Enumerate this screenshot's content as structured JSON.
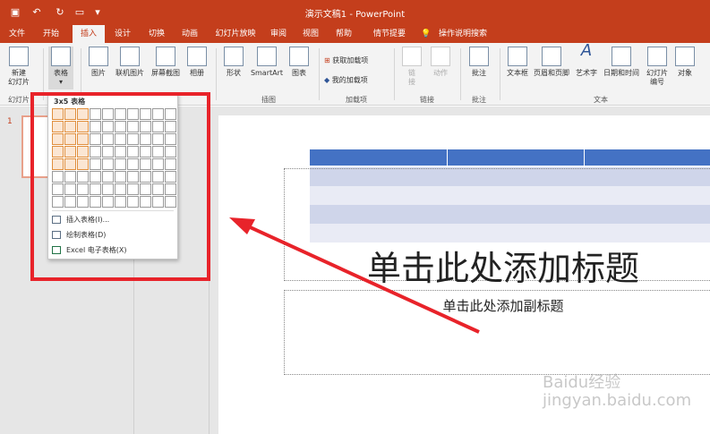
{
  "app": {
    "title": "演示文稿1  -  PowerPoint"
  },
  "quick_access": [
    {
      "icon": "save-icon",
      "glyph": "▣"
    },
    {
      "icon": "undo-icon",
      "glyph": "↶"
    },
    {
      "icon": "redo-icon",
      "glyph": "↻"
    },
    {
      "icon": "start-from-beginning-icon",
      "glyph": "▭"
    },
    {
      "icon": "customize-qat-icon",
      "glyph": "▾"
    }
  ],
  "tabs": [
    "文件",
    "开始",
    "插入",
    "设计",
    "切换",
    "动画",
    "幻灯片放映",
    "审阅",
    "视图",
    "帮助",
    "情节提要"
  ],
  "active_tab": "插入",
  "tell_me": "操作说明搜索",
  "ribbon": {
    "new_slide": "新建\n幻灯片",
    "table": "表格",
    "picture": "图片",
    "online_picture": "联机图片",
    "screenshot": "屏幕截图",
    "album": "相册",
    "shapes": "形状",
    "smartart": "SmartArt",
    "chart": "图表",
    "get_addins": "获取加载项",
    "my_addins": "我的加载项",
    "link": "链\n接",
    "action": "动作",
    "comment": "批注",
    "textbox": "文本框",
    "header_footer": "页眉和页脚",
    "wordart": "艺术字",
    "datetime": "日期和时间",
    "slide_number": "幻灯片\n编号",
    "object": "对象",
    "groups": {
      "slides": "幻灯片",
      "illustrations": "插图",
      "addins": "加载项",
      "links": "链接",
      "comments": "批注",
      "text": "文本"
    }
  },
  "table_dropdown": {
    "title": "3x5 表格",
    "rows": 8,
    "cols": 10,
    "selected_cols": 3,
    "selected_rows": 5,
    "items": [
      "插入表格(I)...",
      "绘制表格(D)",
      "Excel 电子表格(X)"
    ]
  },
  "slide_thumbnail_number": "1",
  "slide": {
    "title_placeholder": "单击此处添加标题",
    "subtitle_placeholder": "单击此处添加副标题"
  },
  "watermark": "Baidu经验\njingyan.baidu.com",
  "colors": {
    "accent": "#c43e1c",
    "annotation": "#e8232a",
    "table_header": "#4472c4"
  }
}
